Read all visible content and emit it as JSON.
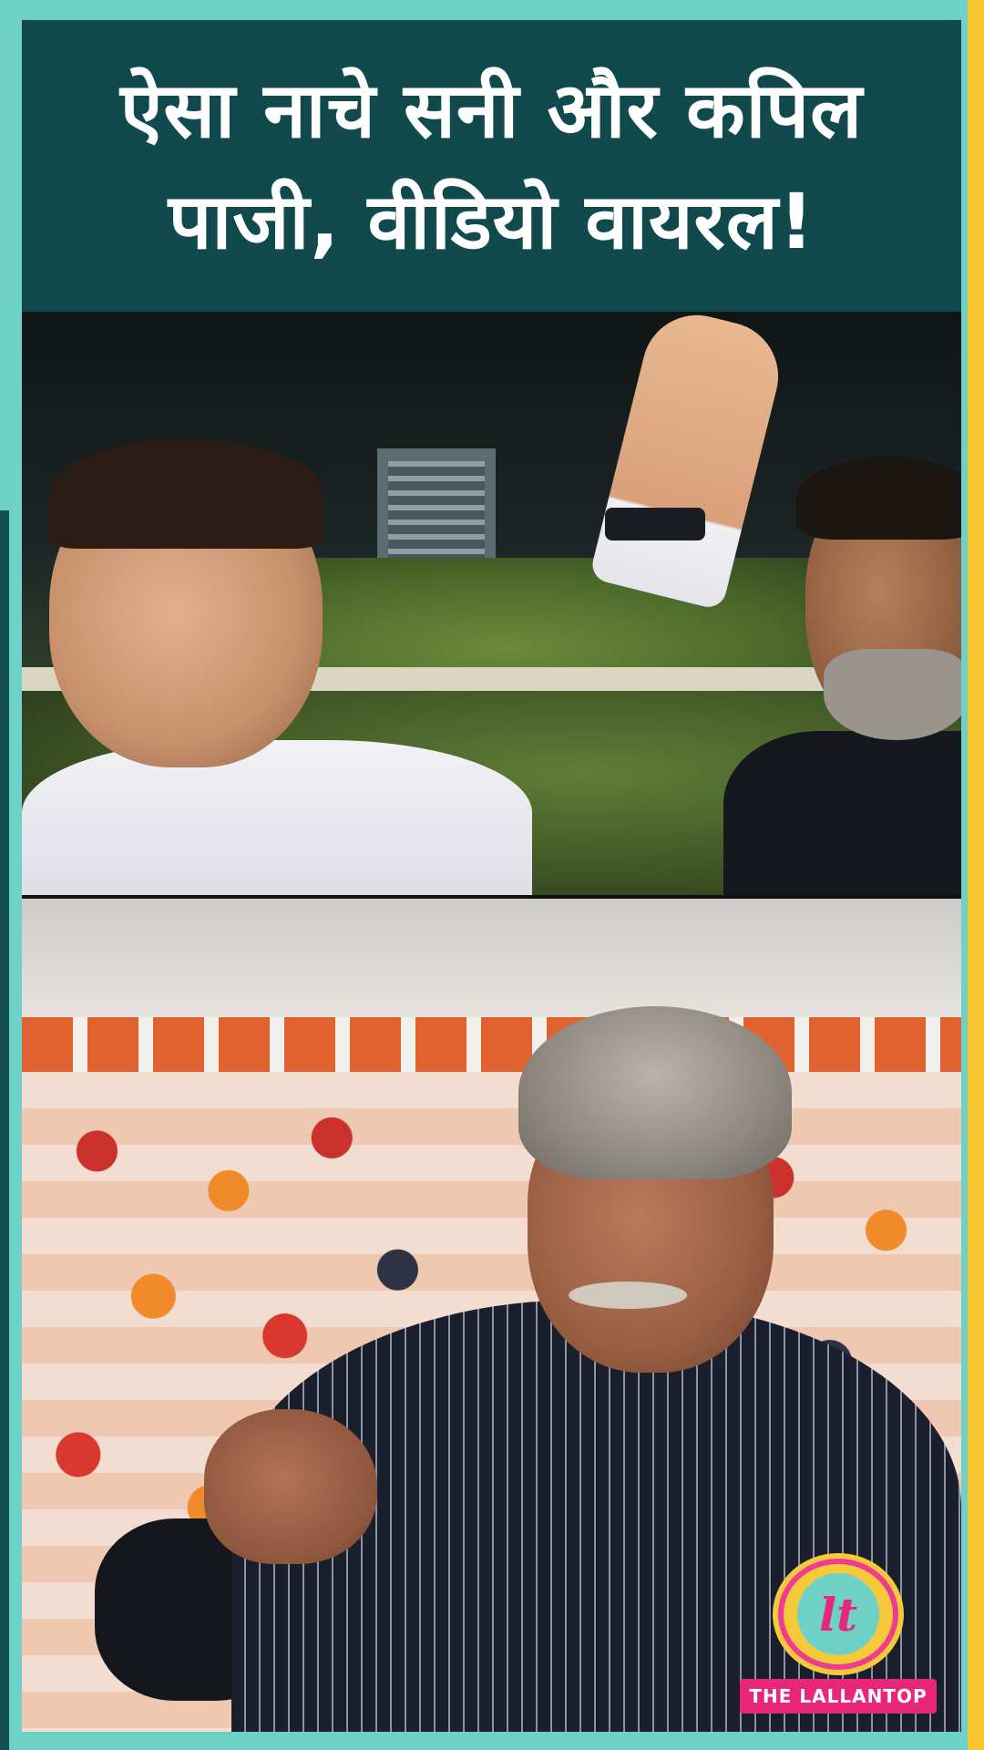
{
  "headline": {
    "line1": "ऐसा नाचे सनी और कपिल",
    "line2": "पाजी, वीडियो वायरल!"
  },
  "logo": {
    "glyph": "lt",
    "text": "THE LALLANTOP"
  },
  "colors": {
    "frame_teal": "#6fd0c7",
    "headline_bg": "#114a4c",
    "accent_yellow": "#f4c531",
    "brand_pink": "#e8267a"
  }
}
